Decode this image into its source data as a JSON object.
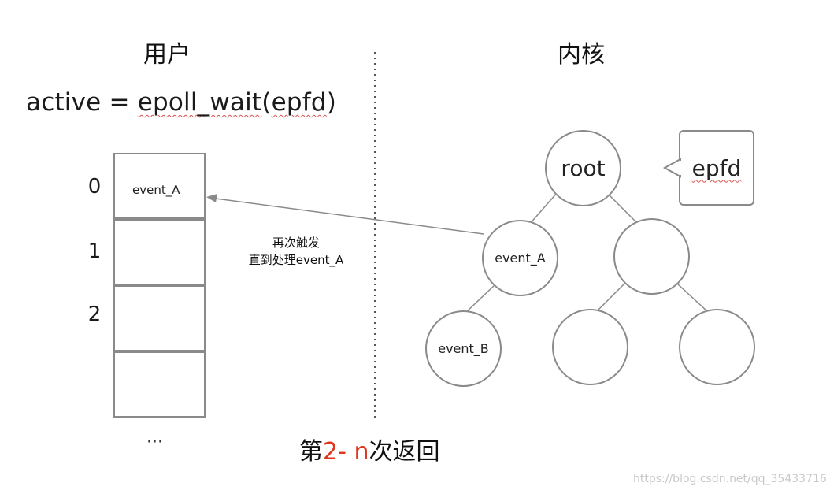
{
  "headings": {
    "user": "用户",
    "kernel": "内核"
  },
  "call": {
    "lhs": "active = ",
    "func": "epoll_wait",
    "open": "(",
    "arg": "epfd",
    "close": ")"
  },
  "array": {
    "indices": [
      "0",
      "1",
      "2"
    ],
    "slot0_label": "event_A",
    "ellipsis": "···"
  },
  "arrow_note": {
    "line1": "再次触发",
    "line2": "直到处理event_A"
  },
  "tree": {
    "root": "root",
    "left": "event_A",
    "left_left": "event_B",
    "callout": "epfd"
  },
  "bottom": {
    "prefix": "第",
    "num1": "2",
    "dash": "- ",
    "n": "n",
    "suffix": "次返回"
  },
  "watermark": "https://blog.csdn.net/qq_35433716",
  "colors": {
    "line": "#8a8a8a",
    "accent_red": "#e0341b",
    "divider": "#555555"
  }
}
